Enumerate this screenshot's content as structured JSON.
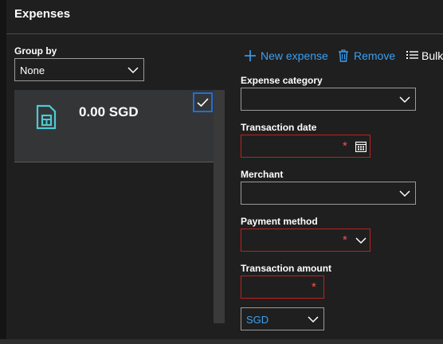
{
  "header": {
    "title": "Expenses"
  },
  "sidebar": {
    "group_by_label": "Group by",
    "group_by_value": "None",
    "card": {
      "amount": "0.00 SGD",
      "selected": true
    }
  },
  "toolbar": {
    "new_expense": "New expense",
    "remove": "Remove",
    "bulk": "Bulk"
  },
  "form": {
    "expense_category": {
      "label": "Expense category",
      "value": ""
    },
    "transaction_date": {
      "label": "Transaction date",
      "value": "",
      "required": "*"
    },
    "merchant": {
      "label": "Merchant",
      "value": ""
    },
    "payment_method": {
      "label": "Payment method",
      "value": "",
      "required": "*"
    },
    "transaction_amount": {
      "label": "Transaction amount",
      "value": "",
      "required": "*"
    },
    "currency": {
      "value": "SGD"
    }
  },
  "colors": {
    "accent": "#3aa0f3",
    "required_border": "#c21f1f",
    "selection_border": "#1e6fd9",
    "card_background": "#333537"
  }
}
